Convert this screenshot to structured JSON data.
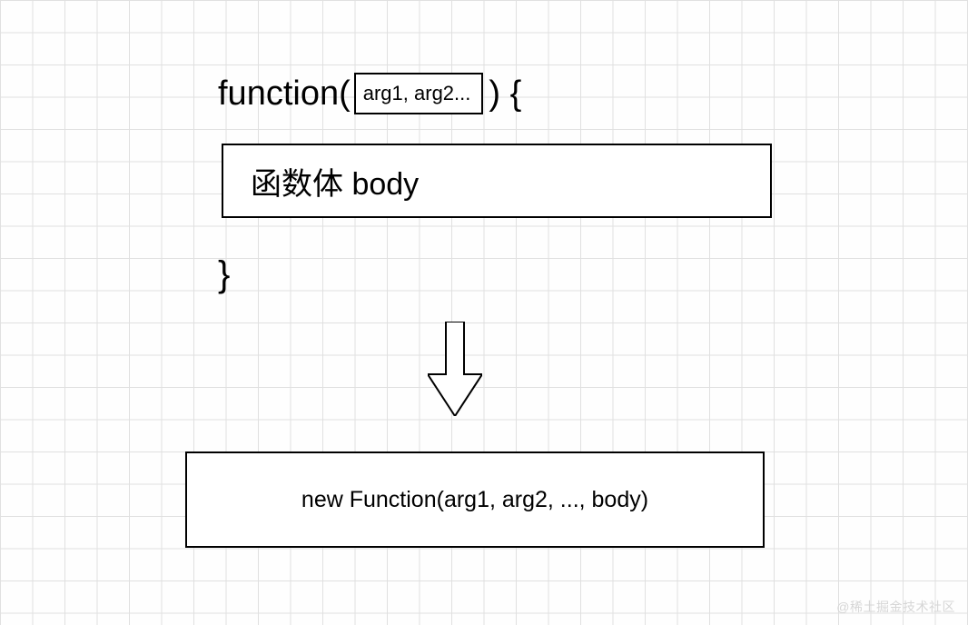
{
  "function_declaration": {
    "keyword_open": "function(",
    "args": "arg1, arg2...",
    "after_args": ") {",
    "body_label": "函数体 body",
    "close_brace": "}"
  },
  "result_box": "new Function(arg1, arg2, ..., body)",
  "watermark": "@稀土掘金技术社区"
}
